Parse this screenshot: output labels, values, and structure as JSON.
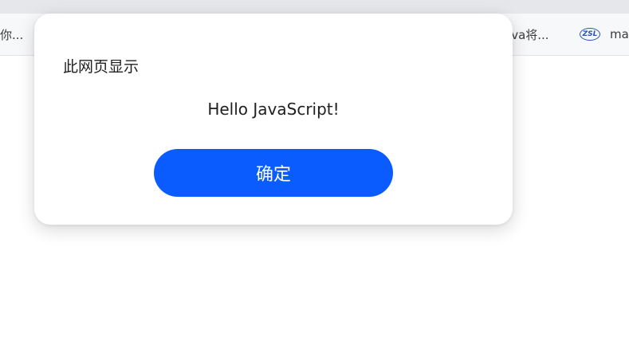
{
  "browser": {
    "bookmarks": [
      {
        "label": "你..."
      },
      {
        "label": "ava将..."
      },
      {
        "label": "ma",
        "icon": "zsl-logo-icon",
        "icon_text": "ZSL"
      }
    ]
  },
  "dialog": {
    "title": "此网页显示",
    "message": "Hello JavaScript!",
    "ok_label": "确定"
  },
  "colors": {
    "accent": "#0b5cff",
    "button_text": "#ffffff",
    "dialog_bg": "#ffffff",
    "toolbar_bg": "#f7f8fa"
  }
}
